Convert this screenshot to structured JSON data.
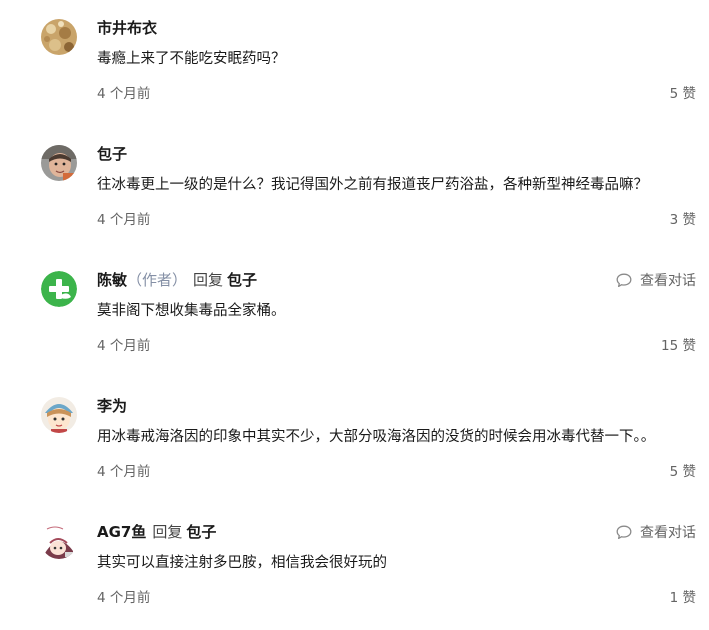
{
  "comments": [
    {
      "author": "市井布衣",
      "content": "毒瘾上来了不能吃安眠药吗？",
      "time": "4 个月前",
      "likes": "5 赞"
    },
    {
      "author": "包子",
      "content": "往冰毒更上一级的是什么？我记得国外之前有报道丧尸药浴盐，各种新型神经毒品嘛？",
      "time": "4 个月前",
      "likes": "3 赞"
    },
    {
      "author": "陈敏",
      "author_tag": "（作者）",
      "reply_word": "回复",
      "reply_to": "包子",
      "view_dialog": "查看对话",
      "content": "莫非阁下想收集毒品全家桶。",
      "time": "4 个月前",
      "likes": "15 赞"
    },
    {
      "author": "李为",
      "content": "用冰毒戒海洛因的印象中其实不少，大部分吸海洛因的没货的时候会用冰毒代替一下。。",
      "time": "4 个月前",
      "likes": "5 赞"
    },
    {
      "author": "AG7鱼",
      "reply_word": "回复",
      "reply_to": "包子",
      "view_dialog": "查看对话",
      "content": "其实可以直接注射多巴胺，相信我会很好玩的",
      "time": "4 个月前",
      "likes": "1 赞"
    }
  ],
  "icons": {
    "speech_bubble": "speech-bubble-icon"
  },
  "colors": {
    "text_primary": "#1a1a1a",
    "text_meta": "#646464",
    "author_tag": "#8590a6",
    "avatar_green": "#3cb44b"
  }
}
